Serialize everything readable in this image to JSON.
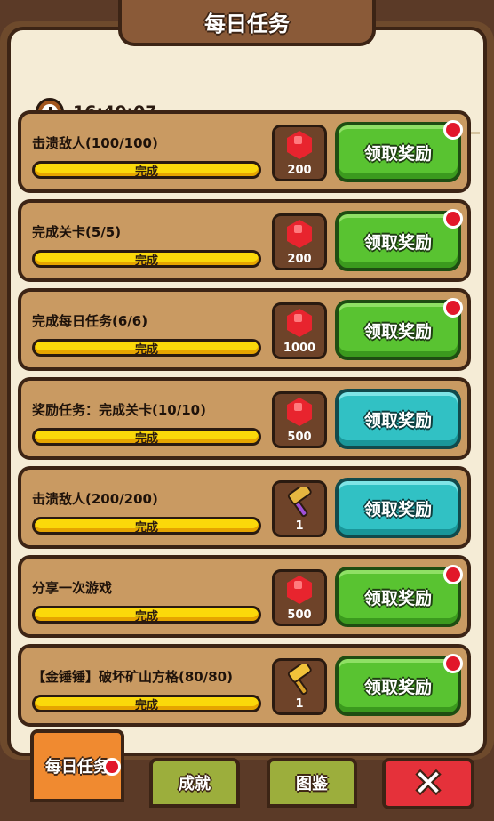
{
  "header": {
    "title": "每日任务"
  },
  "timer": {
    "value": "16:40:07"
  },
  "tasks": [
    {
      "name": "击溃敌人(100/100)",
      "status": "完成",
      "reward_icon": "ruby-gem-icon",
      "reward_qty": "200",
      "button": "领取奖励",
      "button_color": "green",
      "has_dot": true
    },
    {
      "name": "完成关卡(5/5)",
      "status": "完成",
      "reward_icon": "ruby-gem-icon",
      "reward_qty": "200",
      "button": "领取奖励",
      "button_color": "green",
      "has_dot": true
    },
    {
      "name": "完成每日任务(6/6)",
      "status": "完成",
      "reward_icon": "ruby-gem-icon",
      "reward_qty": "1000",
      "button": "领取奖励",
      "button_color": "green",
      "has_dot": true
    },
    {
      "name": "奖励任务：完成关卡(10/10)",
      "status": "完成",
      "reward_icon": "ruby-gem-icon",
      "reward_qty": "500",
      "button": "领取奖励",
      "button_color": "teal",
      "has_dot": false
    },
    {
      "name": "击溃敌人(200/200)",
      "status": "完成",
      "reward_icon": "purple-hammer-icon",
      "reward_qty": "1",
      "button": "领取奖励",
      "button_color": "teal",
      "has_dot": false
    },
    {
      "name": "分享一次游戏",
      "status": "完成",
      "reward_icon": "ruby-gem-icon",
      "reward_qty": "500",
      "button": "领取奖励",
      "button_color": "green",
      "has_dot": true
    },
    {
      "name": "【金锤锤】破坏矿山方格(80/80)",
      "status": "完成",
      "reward_icon": "gold-hammer-icon",
      "reward_qty": "1",
      "button": "领取奖励",
      "button_color": "green",
      "has_dot": true
    }
  ],
  "tabs": {
    "daily": "每日任务",
    "achievements": "成就",
    "gallery": "图鉴",
    "close": "✕"
  },
  "colors": {
    "claim_green": "#59c331",
    "claim_teal": "#31c1c4",
    "progress": "#fbd90a",
    "notify": "#e2172a"
  }
}
